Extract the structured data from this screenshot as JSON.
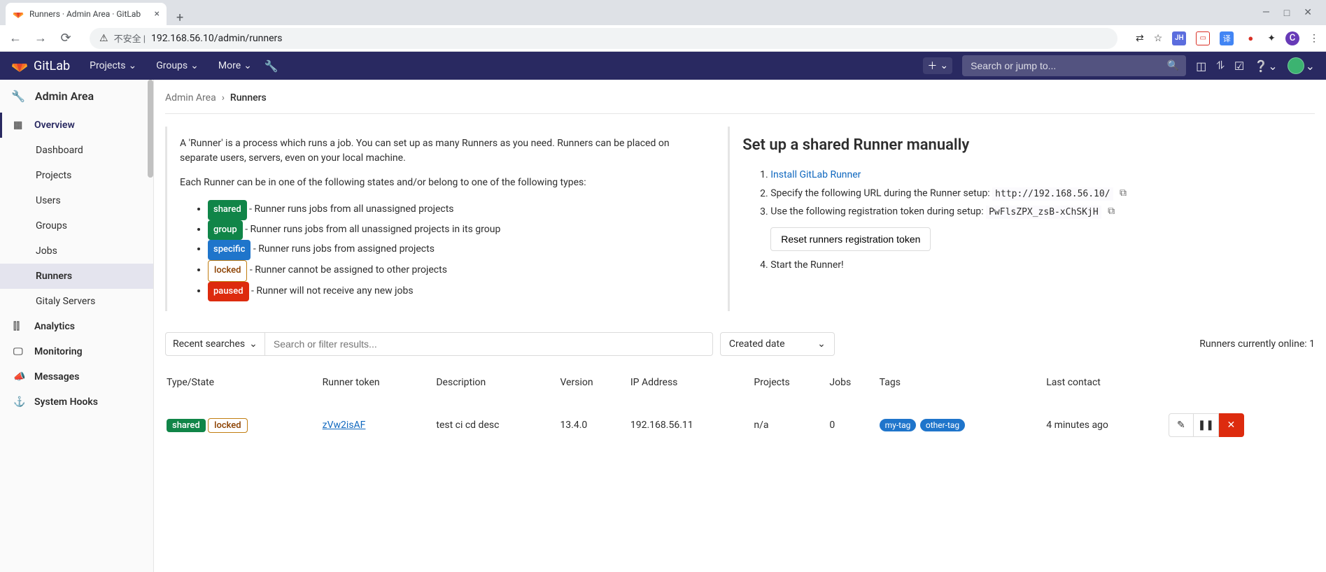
{
  "browser": {
    "tab_title": "Runners · Admin Area · GitLab",
    "url_insecure_label": "不安全 |",
    "url": "192.168.56.10/admin/runners"
  },
  "topnav": {
    "brand": "GitLab",
    "menu": {
      "projects": "Projects",
      "groups": "Groups",
      "more": "More"
    },
    "search_placeholder": "Search or jump to..."
  },
  "sidebar": {
    "header": "Admin Area",
    "sections": {
      "overview": {
        "label": "Overview",
        "items": {
          "dashboard": "Dashboard",
          "projects": "Projects",
          "users": "Users",
          "groups": "Groups",
          "jobs": "Jobs",
          "runners": "Runners",
          "gitaly": "Gitaly Servers"
        }
      },
      "analytics": "Analytics",
      "monitoring": "Monitoring",
      "messages": "Messages",
      "hooks": "System Hooks"
    }
  },
  "breadcrumb": {
    "root": "Admin Area",
    "current": "Runners"
  },
  "info": {
    "p1": "A 'Runner' is a process which runs a job. You can set up as many Runners as you need. Runners can be placed on separate users, servers, even on your local machine.",
    "p2": "Each Runner can be in one of the following states and/or belong to one of the following types:",
    "types": {
      "shared": {
        "badge": "shared",
        "desc": " - Runner runs jobs from all unassigned projects"
      },
      "group": {
        "badge": "group",
        "desc": " - Runner runs jobs from all unassigned projects in its group"
      },
      "specific": {
        "badge": "specific",
        "desc": " - Runner runs jobs from assigned projects"
      },
      "locked": {
        "badge": "locked",
        "desc": " - Runner cannot be assigned to other projects"
      },
      "paused": {
        "badge": "paused",
        "desc": " - Runner will not receive any new jobs"
      }
    }
  },
  "setup": {
    "heading": "Set up a shared Runner manually",
    "step1_link": "Install GitLab Runner",
    "step2_text": "Specify the following URL during the Runner setup: ",
    "step2_url": "http://192.168.56.10/",
    "step3_text": "Use the following registration token during setup: ",
    "step3_token": "PwFlsZPX_zsB-xChSKjH",
    "reset_btn": "Reset runners registration token",
    "step4_text": "Start the Runner!"
  },
  "filter": {
    "recent": "Recent searches",
    "placeholder": "Search or filter results...",
    "sort": "Created date",
    "online_label": "Runners currently online: ",
    "online_count": "1"
  },
  "table": {
    "headers": {
      "type": "Type/State",
      "token": "Runner token",
      "desc": "Description",
      "version": "Version",
      "ip": "IP Address",
      "projects": "Projects",
      "jobs": "Jobs",
      "tags": "Tags",
      "last": "Last contact"
    },
    "rows": [
      {
        "state_shared": "shared",
        "state_locked": "locked",
        "token": "zVw2isAF",
        "desc": "test ci cd desc",
        "version": "13.4.0",
        "ip": "192.168.56.11",
        "projects": "n/a",
        "jobs": "0",
        "tags": [
          "my-tag",
          "other-tag"
        ],
        "last": "4 minutes ago"
      }
    ]
  }
}
